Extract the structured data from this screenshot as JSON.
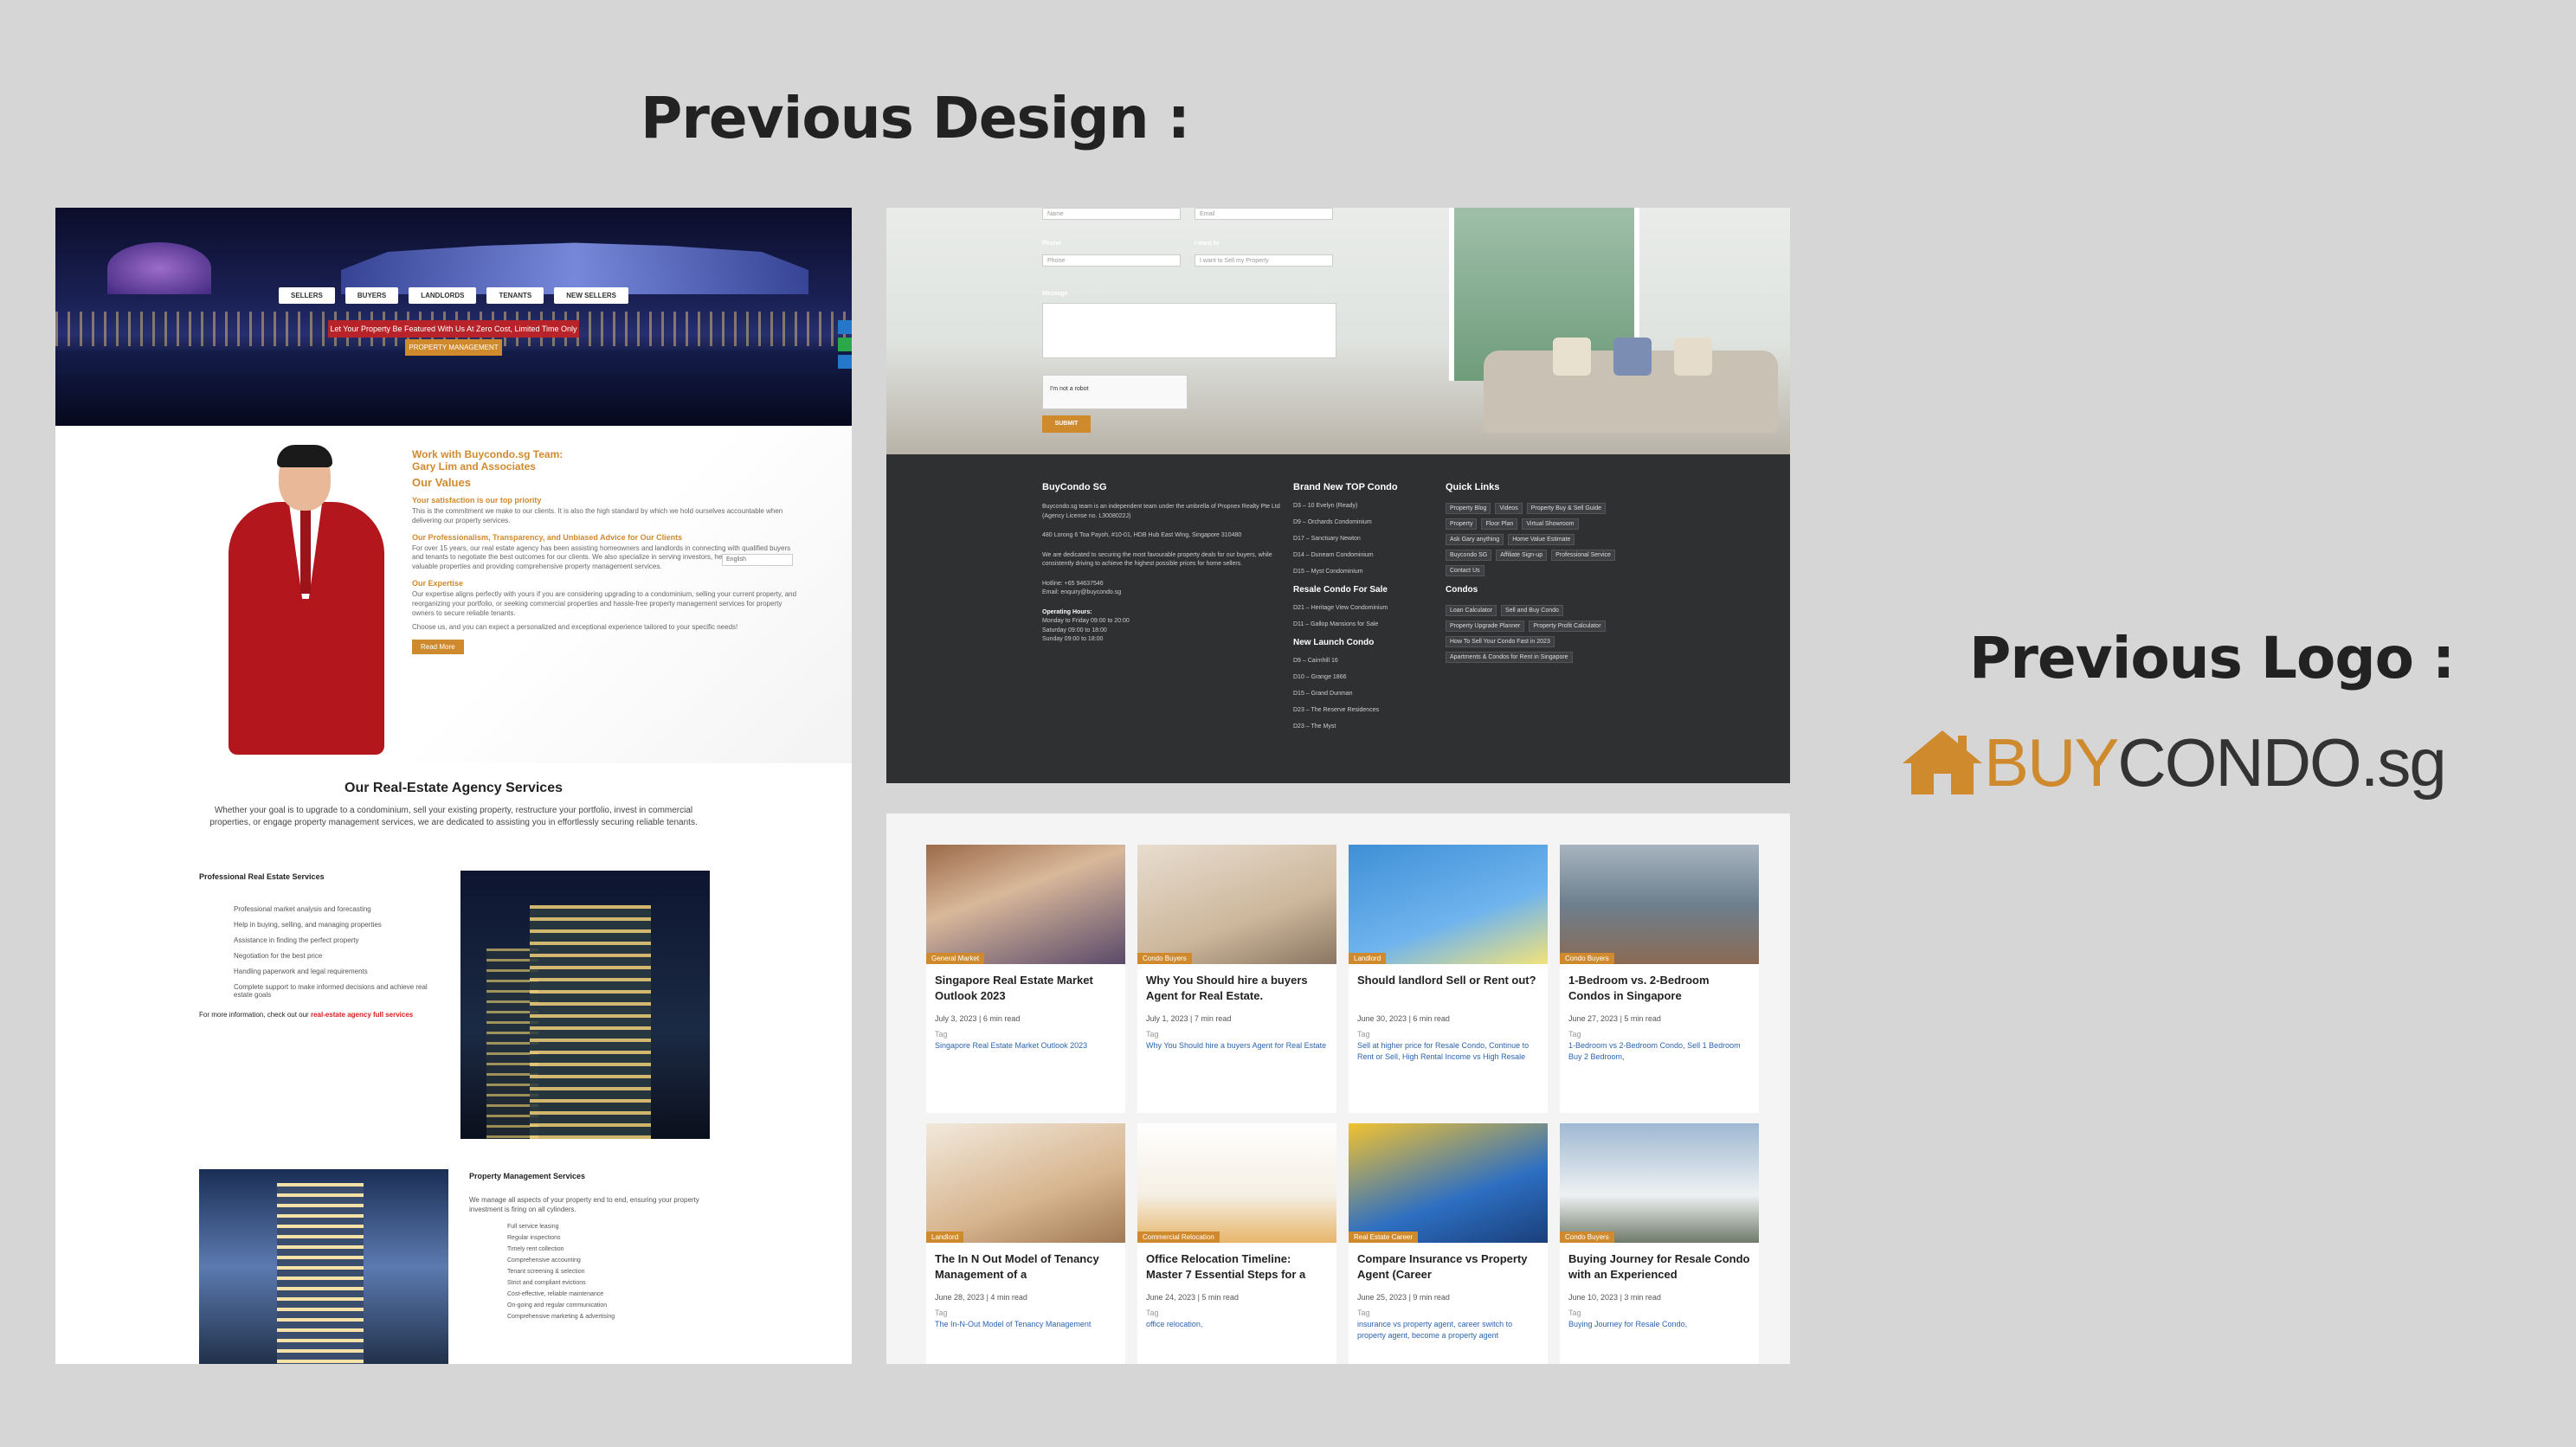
{
  "headings": {
    "previous_design": "Previous Design :",
    "previous_logo": "Previous Logo :"
  },
  "logo": {
    "buy": "BUY",
    "condo": "CONDO",
    "tld": ".sg",
    "icon": "house-icon",
    "brand_color": "#d08a2e",
    "text_color": "#333333"
  },
  "left": {
    "hero_menu": [
      "SELLERS",
      "BUYERS",
      "LANDLORDS",
      "TENANTS",
      "NEW SELLERS"
    ],
    "hero_banner": "Let Your Property Be Featured With Us At Zero Cost, Limited Time Only",
    "hero_button": "PROPERTY MANAGEMENT",
    "values": {
      "t1": "Work with Buycondo.sg Team:",
      "t2": "Gary Lim and Associates",
      "t3": "Our Values",
      "s1": "Your satisfaction is our top priority",
      "p1": "This is the commitment we make to our clients. It is also the high standard by which we hold ourselves accountable when delivering our property services.",
      "s2": "Our Professionalism, Transparency, and Unbiased Advice for Our Clients",
      "p2": "For over 15 years, our real estate agency has been assisting homeowners and landlords in connecting with qualified buyers and tenants to negotiate the best outcomes for our clients. We also specialize in serving investors, helping them identify valuable properties and providing comprehensive property management services.",
      "s3": "Our Expertise",
      "p3": "Our expertise aligns perfectly with yours if you are considering upgrading to a condominium, selling your current property, and reorganizing your portfolio, or seeking commercial properties and hassle-free property management services for property owners to secure reliable tenants.",
      "p4": "Choose us, and you can expect a personalized and exceptional experience tailored to your specific needs!",
      "button": "Read More",
      "lang": "English"
    },
    "services": {
      "title": "Our Real-Estate Agency Services",
      "desc": "Whether your goal is to upgrade to a condominium, sell your existing property, restructure your portfolio, invest in commercial properties, or engage property management services, we are dedicated to assisting you in effortlessly securing reliable tenants.",
      "pro_title": "Professional Real Estate Services",
      "pro_items": [
        "Professional market analysis and forecasting",
        "Help in buying, selling, and managing properties",
        "Assistance in finding the perfect property",
        "Negotiation for the best price",
        "Handling paperwork and legal requirements",
        "Complete support to make informed decisions and achieve real estate goals"
      ],
      "more": "For more information, check out our",
      "more_link": "real-estate agency full services",
      "pm_title": "Property Management Services",
      "pm_desc": "We manage all aspects of your property end to end, ensuring your property investment is firing on all cylinders.",
      "pm_items": [
        "Full service leasing",
        "Regular inspections",
        "Timely rent collection",
        "Comprehensive accounting",
        "Tenant screening & selection",
        "Strict and compliant evictions",
        "Cost-effective, reliable maintenance",
        "On-going and regular communication",
        "Comprehensive marketing & advertising"
      ]
    }
  },
  "form": {
    "name": "Name",
    "email": "Email",
    "phone_label": "Phone",
    "phone": "Phone",
    "iam_label": "I want to",
    "iam": "I want to Sell my Property",
    "message_label": "Message",
    "captcha": "I'm not a robot",
    "submit": "SUBMIT"
  },
  "footer": {
    "brand": "BuyCondo SG",
    "about": "Buycondo.sg team is an independent team under the umbrella of Propnex Realty Pte Ltd (Agency License no. L3008022J)",
    "address": "480 Lorong 6 Toa Payoh, #10-01, HDB Hub East Wing, Singapore 310480",
    "mission": "We are dedicated to securing the most favourable property deals for our buyers, while consistently driving to achieve the highest possible prices for home sellers.",
    "hotline": "Hotline: +65 94637546",
    "email": "Email: enquiry@buycondo.sg",
    "hours_title": "Operating Hours:",
    "hours": [
      "Monday to Friday  09:00 to 20:00",
      "Saturday  09:00 to 18:00",
      "Sunday  09:00 to 18:00"
    ],
    "col2_title": "Brand New TOP Condo",
    "col2_items": [
      "D3 – 10 Evelyn (Ready)",
      "D9 – Orchards Condominium",
      "D17 – Sanctuary Newton",
      "D14 – Dunearn Condominium",
      "D15 – Myst Condominium"
    ],
    "col2_title2": "Resale Condo For Sale",
    "col2_items2": [
      "D21 – Heritage View Condominium",
      "D11 – Gallop Mansions for Sale"
    ],
    "col2_title3": "New Launch Condo",
    "col2_items3": [
      "D9 – Cairnhill 16",
      "D10 – Grange 1866",
      "D15 – Grand Dunman",
      "D23 – The Reserve Residences",
      "D23 – The Myst"
    ],
    "col3_title": "Quick Links",
    "links": [
      "Property Blog",
      "Videos",
      "Property Buy & Sell Guide",
      "Property",
      "Floor Plan",
      "Virtual Showroom",
      "Ask Gary anything",
      "Home Value Estimate",
      "Buycondo SG",
      "Affiliate Sign-up",
      "Professional Service",
      "Contact Us"
    ],
    "col3_title2": "Condos",
    "condo_links": [
      "Loan Calculator",
      "Sell and Buy Condo",
      "Property Upgrade Planner",
      "Property Profit Calculator",
      "How To Sell Your Condo Fast in 2023",
      "Apartments & Condos for Rent in Singapore"
    ]
  },
  "blog": [
    {
      "cat": "General Market",
      "title": "Singapore Real Estate Market Outlook 2023",
      "date": "July 3, 2023",
      "read": "6 min read",
      "tags": "Singapore Real Estate Market Outlook 2023",
      "img": "city-model"
    },
    {
      "cat": "Condo Buyers",
      "title": "Why You Should hire a buyers Agent for Real Estate.",
      "date": "July 1, 2023",
      "read": "7 min read",
      "tags": "Why You Should hire a buyers Agent for Real Estate",
      "img": "woman-couch"
    },
    {
      "cat": "Landlord",
      "title": "Should landlord Sell or Rent out?",
      "date": "June 30, 2023",
      "read": "6 min read",
      "tags": "Sell at higher price for Resale Condo, Continue to Rent or Sell, High Rental Income vs High Resale",
      "img": "woman-house"
    },
    {
      "cat": "Condo Buyers",
      "title": "1-Bedroom vs. 2-Bedroom Condos in Singapore",
      "date": "June 27, 2023",
      "read": "5 min read",
      "tags": "1-Bedroom vs 2-Bedroom Condo, Sell 1 Bedroom Buy 2 Bedroom,",
      "img": "balcony"
    },
    {
      "cat": "Landlord",
      "title": "The In N Out Model of Tenancy Management of a",
      "date": "June 28, 2023",
      "read": "4 min read",
      "tags": "The In-N-Out Model of Tenancy Management",
      "img": "family-boxes"
    },
    {
      "cat": "Commercial Relocation",
      "title": "Office Relocation Timeline: Master 7 Essential Steps for a",
      "date": "June 24, 2023",
      "read": "5 min read",
      "tags": "office relocation,",
      "img": "timeline"
    },
    {
      "cat": "Real Estate Career",
      "title": "Compare Insurance vs Property Agent (Career",
      "date": "June 25, 2023",
      "read": "9 min read",
      "tags": "insurance vs property agent, career switch to property agent, become a property agent",
      "img": "career"
    },
    {
      "cat": "Condo Buyers",
      "title": "Buying Journey for Resale Condo with an Experienced",
      "date": "June 10, 2023",
      "read": "3 min read",
      "tags": "Buying Journey for Resale Condo,",
      "img": "houses"
    }
  ],
  "tag_label": "Tag"
}
